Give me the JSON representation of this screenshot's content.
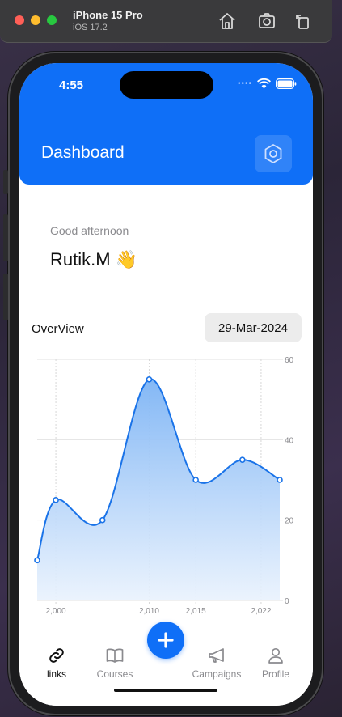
{
  "simulator": {
    "device_name": "iPhone 15 Pro",
    "os_version": "iOS 17.2",
    "icons": [
      "home-icon",
      "screenshot-icon",
      "rotate-icon"
    ]
  },
  "status_bar": {
    "time": "4:55"
  },
  "header": {
    "title": "Dashboard",
    "settings_icon": "hexagon-settings-icon"
  },
  "greeting": {
    "subtitle": "Good afternoon",
    "user_name": "Rutik.M 👋"
  },
  "overview": {
    "label": "OverView",
    "date": "29-Mar-2024"
  },
  "chart_data": {
    "type": "area",
    "title": "",
    "xlabel": "",
    "ylabel": "",
    "x": [
      1998,
      2000,
      2005,
      2010,
      2015,
      2020,
      2024
    ],
    "series": [
      {
        "values": [
          10,
          25,
          20,
          55,
          30,
          35,
          30
        ]
      }
    ],
    "x_ticks": [
      2000,
      2010,
      2015,
      2022
    ],
    "x_tick_labels": [
      "2,000",
      "2,010",
      "2,015",
      "2,022"
    ],
    "y_ticks": [
      0,
      20,
      40,
      60
    ],
    "ylim": [
      0,
      60
    ],
    "xlim": [
      1998,
      2024
    ],
    "grid": true,
    "y_axis_side": "right",
    "color": "#1a73e8"
  },
  "tabbar": {
    "tabs": [
      {
        "label": "links",
        "icon": "link-icon",
        "active": true
      },
      {
        "label": "Courses",
        "icon": "book-icon",
        "active": false
      },
      {
        "label": "Campaigns",
        "icon": "megaphone-icon",
        "active": false
      },
      {
        "label": "Profile",
        "icon": "person-icon",
        "active": false
      }
    ],
    "fab_icon": "plus-icon"
  },
  "colors": {
    "primary": "#0f6ff7",
    "chart_line": "#1a73e8"
  }
}
